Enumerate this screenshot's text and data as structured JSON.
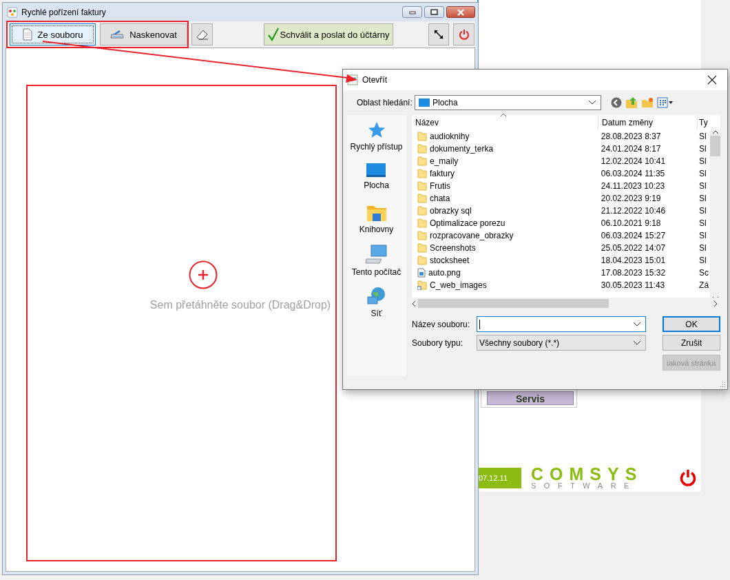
{
  "main_window": {
    "title": "Rychlé pořízení faktury",
    "toolbar": [
      {
        "kind": "file",
        "label": "Ze souboru",
        "focused": true
      },
      {
        "kind": "scan",
        "label": "Naskenovat",
        "focused": false
      },
      {
        "kind": "eraser",
        "focused": false
      },
      {
        "kind": "approve",
        "label": "Schválit a poslat do účtárny",
        "focused": false
      },
      {
        "kind": "expand",
        "focused": false
      },
      {
        "kind": "power",
        "focused": false
      }
    ],
    "drop_zone": {
      "text": "Sem přetáhněte soubor (Drag&Drop)"
    }
  },
  "background_app": {
    "button": "Servis",
    "date": "07.12.11",
    "logo_top": "COMSYS",
    "logo_bottom": "SOFTWARE"
  },
  "dialog": {
    "title": "Otevřít",
    "look_in": {
      "label": "Oblast hledání:",
      "value": "Plocha"
    },
    "places": [
      {
        "kind": "quick",
        "label": "Rychlý přístup"
      },
      {
        "kind": "desktop",
        "label": "Plocha"
      },
      {
        "kind": "library",
        "label": "Knihovny"
      },
      {
        "kind": "computer",
        "label": "Tento počítač"
      },
      {
        "kind": "network",
        "label": "Síť"
      }
    ],
    "columns": [
      "Název",
      "Datum změny",
      "Ty"
    ],
    "rows": [
      {
        "kind": "folder",
        "name": "audioknihy",
        "date": "28.08.2023 8:37",
        "type": "Sl"
      },
      {
        "kind": "folder",
        "name": "dokumenty_terka",
        "date": "24.01.2024 8:17",
        "type": "Sl"
      },
      {
        "kind": "folder",
        "name": "e_maily",
        "date": "12.02.2024 10:41",
        "type": "Sl"
      },
      {
        "kind": "folder",
        "name": "faktury",
        "date": "06.03.2024 11:35",
        "type": "Sl"
      },
      {
        "kind": "folder",
        "name": "Frutis",
        "date": "24.11.2023 10:23",
        "type": "Sl"
      },
      {
        "kind": "folder",
        "name": "chata",
        "date": "20.02.2023 9:19",
        "type": "Sl"
      },
      {
        "kind": "folder",
        "name": "obrazky sql",
        "date": "21.12.2022 10:46",
        "type": "Sl"
      },
      {
        "kind": "folder",
        "name": "Optimalizace porezu",
        "date": "06.10.2021 9:18",
        "type": "Sl"
      },
      {
        "kind": "folder",
        "name": "rozpracovane_obrazky",
        "date": "06.03.2024 15:27",
        "type": "Sl"
      },
      {
        "kind": "folder",
        "name": "Screenshots",
        "date": "25.05.2022 14:07",
        "type": "Sl"
      },
      {
        "kind": "folder",
        "name": "stocksheet",
        "date": "18.04.2023 15:01",
        "type": "Sl"
      },
      {
        "kind": "image",
        "name": "auto.png",
        "date": "17.08.2023 15:32",
        "type": "Sc"
      },
      {
        "kind": "shortcut",
        "name": "C_web_images",
        "date": "30.05.2023 11:43",
        "type": "Zá"
      }
    ],
    "file_name": {
      "label": "Název souboru:",
      "focused": true
    },
    "file_type": {
      "label": "Soubory typu:",
      "value": "Všechny soubory (*.*)"
    },
    "buttons": [
      {
        "label": "OK",
        "default": true,
        "disabled": false
      },
      {
        "label": "Zrušit",
        "default": false,
        "disabled": false
      },
      {
        "label": "iaková stránka",
        "default": false,
        "disabled": true
      }
    ]
  }
}
